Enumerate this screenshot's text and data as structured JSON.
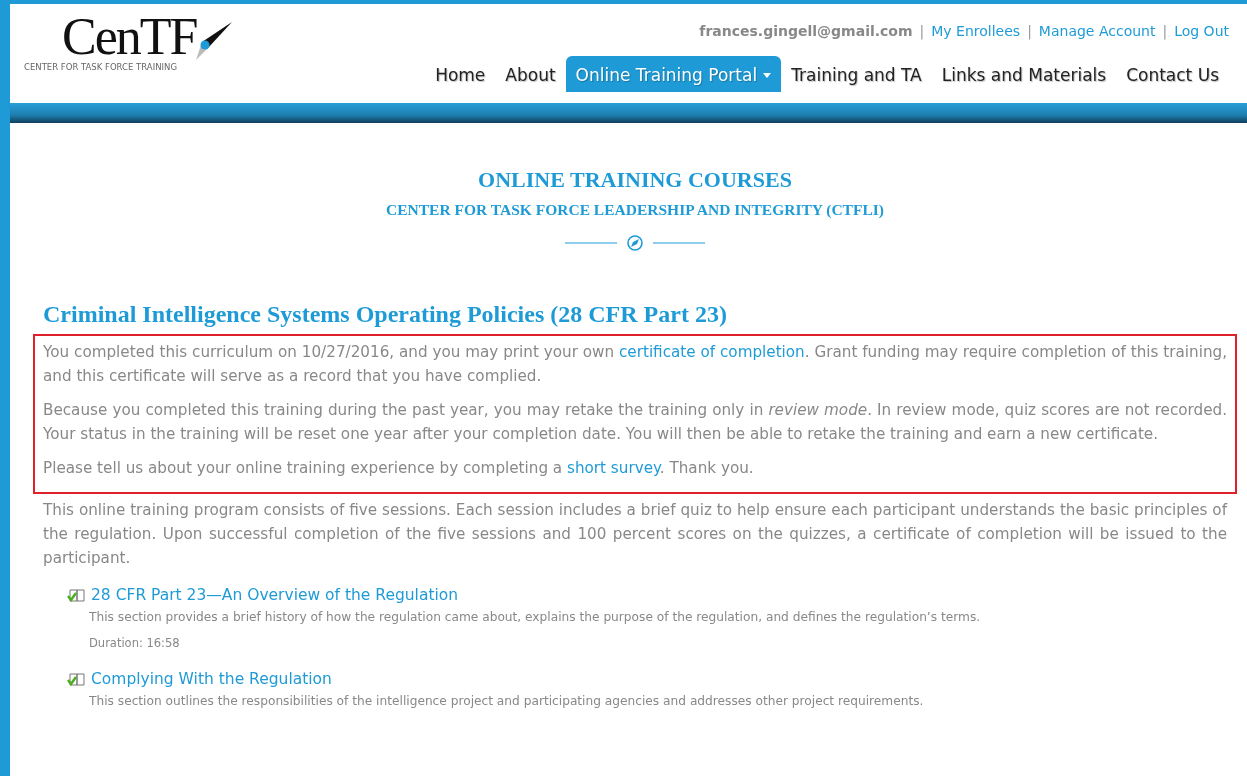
{
  "logo": {
    "name": "CenTF",
    "tagline": "CENTER FOR TASK FORCE TRAINING"
  },
  "account_links": [
    {
      "text": "frances.gingell@gmail.com",
      "kind": "user"
    },
    {
      "text": "My Enrollees",
      "kind": "link"
    },
    {
      "text": "Manage Account",
      "kind": "link"
    },
    {
      "text": "Log Out",
      "kind": "link"
    }
  ],
  "account_separator": "|",
  "nav": [
    {
      "label": "Home",
      "selected": false
    },
    {
      "label": "About",
      "selected": false
    },
    {
      "label": "Online Training Portal",
      "selected": true,
      "dropdown": true
    },
    {
      "label": "Training and TA",
      "selected": false
    },
    {
      "label": "Links and Materials",
      "selected": false
    },
    {
      "label": "Contact Us",
      "selected": false
    }
  ],
  "page_title": "ONLINE TRAINING COURSES",
  "page_subtitle": "CENTER FOR TASK FORCE LEADERSHIP AND INTEGRITY (CTFLI)",
  "course_title": "Criminal Intelligence Systems Operating Policies (28 CFR Part 23)",
  "notice": [
    {
      "before": "You completed this curriculum on 10/27/2016, and you may print your own ",
      "link": "certificate of completion",
      "after": ". Grant funding may require completion of this training, and this certificate will serve as a record that you have complied."
    },
    {
      "before": "Because you completed this training during the past year, you may retake the training only in *review mode*. In review mode, quiz scores are not recorded. Your status in the training will be reset one year after your completion date. You will then be able to retake the training and earn a new certificate."
    },
    {
      "before": "Please tell us about your online training experience by completing a ",
      "link": "short survey",
      "after": ". Thank you."
    }
  ],
  "intro": "This online training program consists of five sessions. Each session includes a brief quiz to help ensure each participant understands the basic principles of the regulation. Upon successful completion of the five sessions and 100 percent scores on the quizzes, a certificate of completion will be issued to the participant.",
  "sessions": [
    {
      "title": "28 CFR Part 23—An Overview of the Regulation",
      "description": "This section provides a brief history of how the regulation came about, explains the purpose of the regulation, and defines the regulation’s terms.",
      "duration": "Duration: 16:58",
      "completed": true
    },
    {
      "title": "Complying With the Regulation",
      "description": "This section outlines the responsibilities of the intelligence project and participating agencies and addresses other project requirements.",
      "completed": true
    }
  ]
}
